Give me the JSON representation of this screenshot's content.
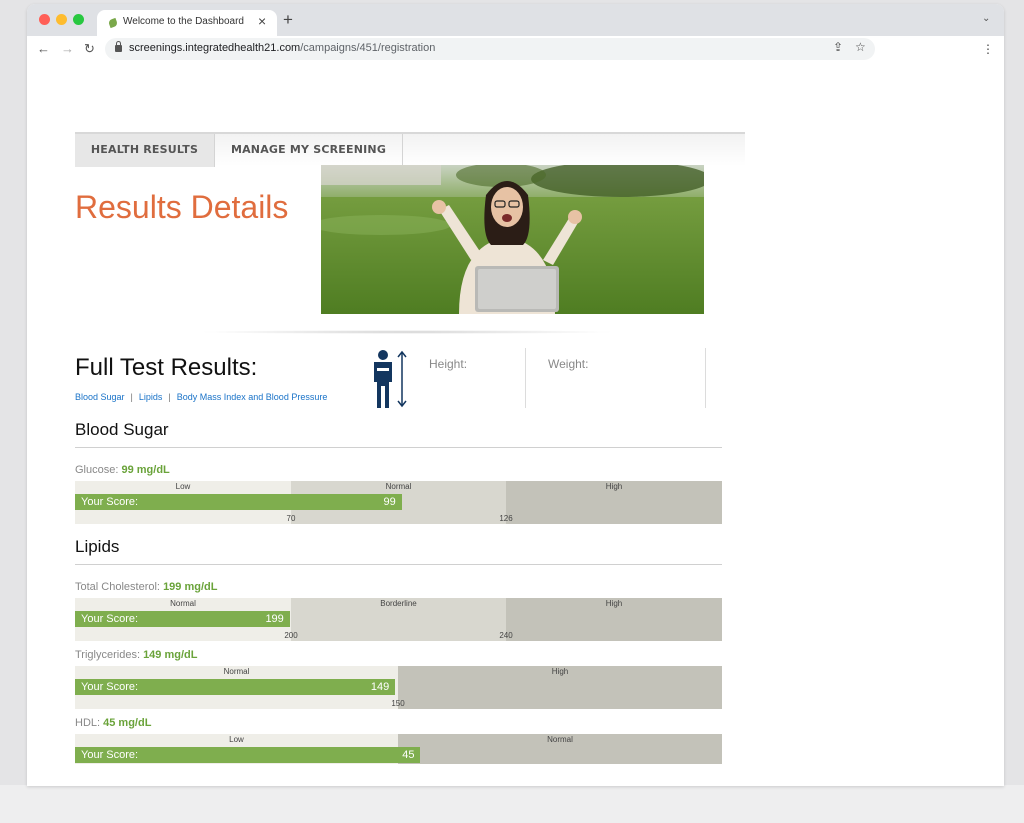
{
  "browser": {
    "tab_title": "Welcome to the Dashboard",
    "tab_close": "×",
    "new_tab": "+",
    "url_host": "screenings.integratedhealth21.com",
    "url_path": "/campaigns/451/registration"
  },
  "nav": {
    "tabs": [
      "HEALTH RESULTS",
      "MANAGE MY SCREENING"
    ]
  },
  "page": {
    "title": "Results Details"
  },
  "full_results": {
    "title": "Full Test Results:",
    "links": [
      "Blood Sugar",
      "Lipids",
      "Body Mass Index and Blood Pressure"
    ],
    "separator": "|",
    "height_label": "Height:",
    "weight_label": "Weight:"
  },
  "sections": {
    "blood_sugar": {
      "title": "Blood Sugar",
      "glucose": {
        "label": "Glucose:",
        "value": "99 mg/dL",
        "score_label": "Your Score:",
        "score": "99",
        "score_fraction": 0.505,
        "ranges": [
          "Low",
          "Normal",
          "High"
        ],
        "ticks": [
          "70",
          "126"
        ]
      }
    },
    "lipids": {
      "title": "Lipids",
      "total_cholesterol": {
        "label": "Total Cholesterol:",
        "value": "199 mg/dL",
        "score_label": "Your Score:",
        "score": "199",
        "score_fraction": 0.332,
        "ranges": [
          "Normal",
          "Borderline",
          "High"
        ],
        "ticks": [
          "200",
          "240"
        ]
      },
      "triglycerides": {
        "label": "Triglycerides:",
        "value": "149 mg/dL",
        "score_label": "Your Score:",
        "score": "149",
        "score_fraction": 0.495,
        "ranges": [
          "Normal",
          "High"
        ],
        "ticks": [
          "150"
        ]
      },
      "hdl": {
        "label": "HDL:",
        "value": "45 mg/dL",
        "score_label": "Your Score:",
        "score": "45",
        "score_fraction": 0.534,
        "ranges": [
          "Low",
          "Normal"
        ]
      }
    }
  },
  "colors": {
    "title_orange": "#e06d3e",
    "score_green": "#7fae4e",
    "value_green": "#6aa33a",
    "link_blue": "#1a73c8",
    "range_light": "#efeee8",
    "range_mid": "#d8d7cf",
    "range_dark": "#c3c2b9",
    "icon_navy": "#13365f"
  },
  "icons": {
    "back": "arrow-left-icon",
    "forward": "arrow-right-icon",
    "reload": "reload-icon",
    "lock": "lock-icon",
    "share": "share-icon",
    "bookmark": "star-icon",
    "menu": "kebab-menu-icon",
    "body": "body-height-icon"
  }
}
